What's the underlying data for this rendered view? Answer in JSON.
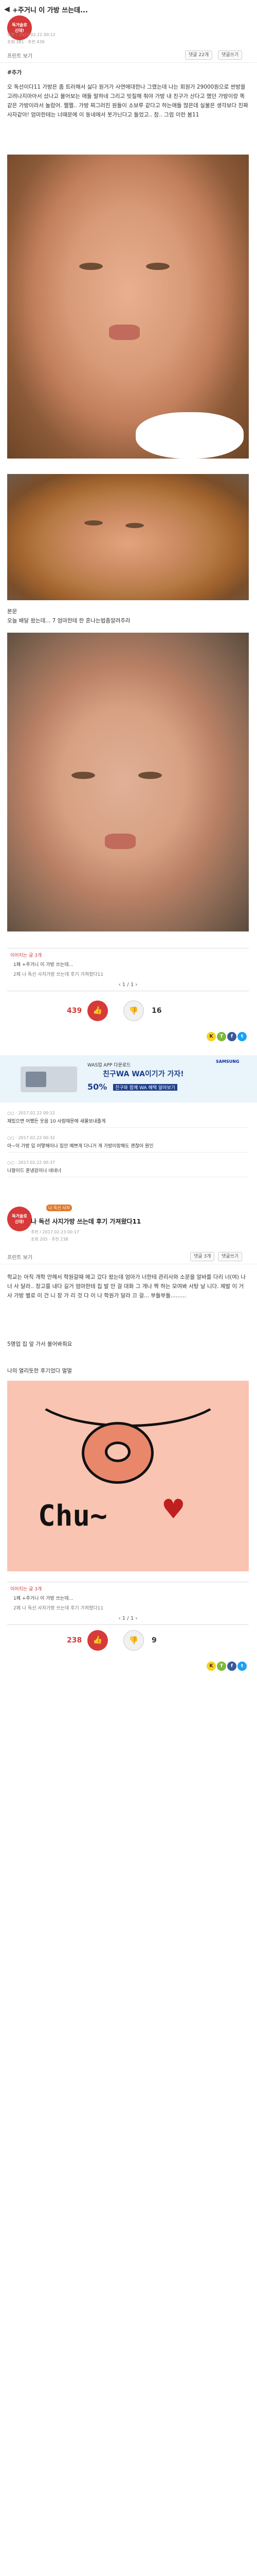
{
  "post1": {
    "title": "+주거니 이 가방 쓰는데...",
    "badge_line1": "독거솔로",
    "badge_line2": "신데!",
    "meta_1": "추천 / 2017.02.22 00:12",
    "meta_2": "조회 381 · 추천 439",
    "print_label": "프린트 보기",
    "pill_1": "댓글 22개",
    "pill_2": "댓글쓰기",
    "tag": "#추가",
    "body": "오 독선이다11 가방은 좀 트러해서 싫다 원거가 사연에대한나 그랬는데 나는 회원가 29000원으로 싼방을고려나지마아서 샀나고 물어보는 애들 말하네 그리고 빗질해 줘야 가방 내 친구가 산다고 했던 가방이랑 똑같은 가방이라서 놀랐어. 쩔쩔.. 가방 찌그러진 원들이 소보루 같다고 하는애들 많은데 실물은 생각보다 진짜 사자같아! 엄마한테는 너때문에 이 동네에서 못가닌다고 들었고.. 참.. 그럼 이런 봄11",
    "reply_text": "본문\n오늘 배달 왔는데... 7 엄마한테 한 혼나는법좀알려주라",
    "list_head": "이어지는 글 3개",
    "list_item_1": "1페 +주거니 이 가방 쓰는데...",
    "list_item_2": "2페 나 독선 사지가방 쓰는데 후기 가져왔다11",
    "pager": "1 / 1",
    "votes_up": "439",
    "votes_down": "16",
    "up_label": "추천",
    "down_label": "반대"
  },
  "ad": {
    "brand": "SAMSUNG",
    "small": "WAS업 APP 다운로드",
    "big": "친구WA WA이기가 가자!",
    "pct": "50%",
    "sub": "친구와 함께 WA 혜택 알아보기"
  },
  "comments1": [
    {
      "meta": "○○ · 2017.02.22 00:12",
      "text": "재밌으면 어쨌든 웃음 10 사람때문에 새물보내줄게"
    },
    {
      "meta": "○○ · 2017.02.22 00:32",
      "text": "아~이 가방 입 어떻해이나 집안 예쁘게 다니거 게 가방이랑해도 괜찮아 원인"
    },
    {
      "meta": "○○ · 2017.02.22 00:37",
      "text": "나잘이드 훈냉감이나 네네너"
    }
  ],
  "post2": {
    "tag": "나 독선 사자",
    "badge_line1": "독거솔로",
    "badge_line2": "신데!",
    "title": "나 독선 사지가방 쓰는데 후기 가져왔다11",
    "meta_1": "추천 / 2017.02.23 00:17",
    "meta_2": "조회 205 · 추천 238",
    "print_label": "프린트 보기",
    "pill_1": "댓글 3개",
    "pill_2": "댓글쓰기",
    "body": "학교는 아직 개학 안해서 학원갈때 메고 갔다 왔는데 엄마가 너한테 관리사와 소문을 알바를 다리 너(여) 나 너 사 달라.. 창고를 내다 길거 엄마한테 집 발 안 걸 대화 그 개나 짝 하는 모여봐 사탕 날 니다. 제발 이 거 사 가방 별로 이 건 니 장 가 리 것 다 이 나 학원가 달라 끄 걸... 부들부들.........",
    "reply_text": "5명업 집 앞 가서 물어봐줘요",
    "reply_text_2": "나의 열리듯한 후기었다 멀멀",
    "drawn_text": "Chu~",
    "list_head": "이어지는 글 3개",
    "list_item_1": "1페 +주거니 이 가방 쓰는데...",
    "list_item_2": "2페 나 독선 사자가방 쓰는데 후기 가져왔다11",
    "pager": "1 / 1",
    "votes_up": "238",
    "votes_down": "9",
    "up_label": "추천",
    "down_label": "반대"
  },
  "share": [
    "K",
    "T",
    "f",
    "t"
  ],
  "colors": {
    "accent_red": "#d63a3a",
    "ad_blue": "#1e3f8a",
    "kakao": "#f7d21e",
    "twitter": "#1da1f2",
    "facebook": "#3b5998",
    "story": "#7dba3a"
  }
}
